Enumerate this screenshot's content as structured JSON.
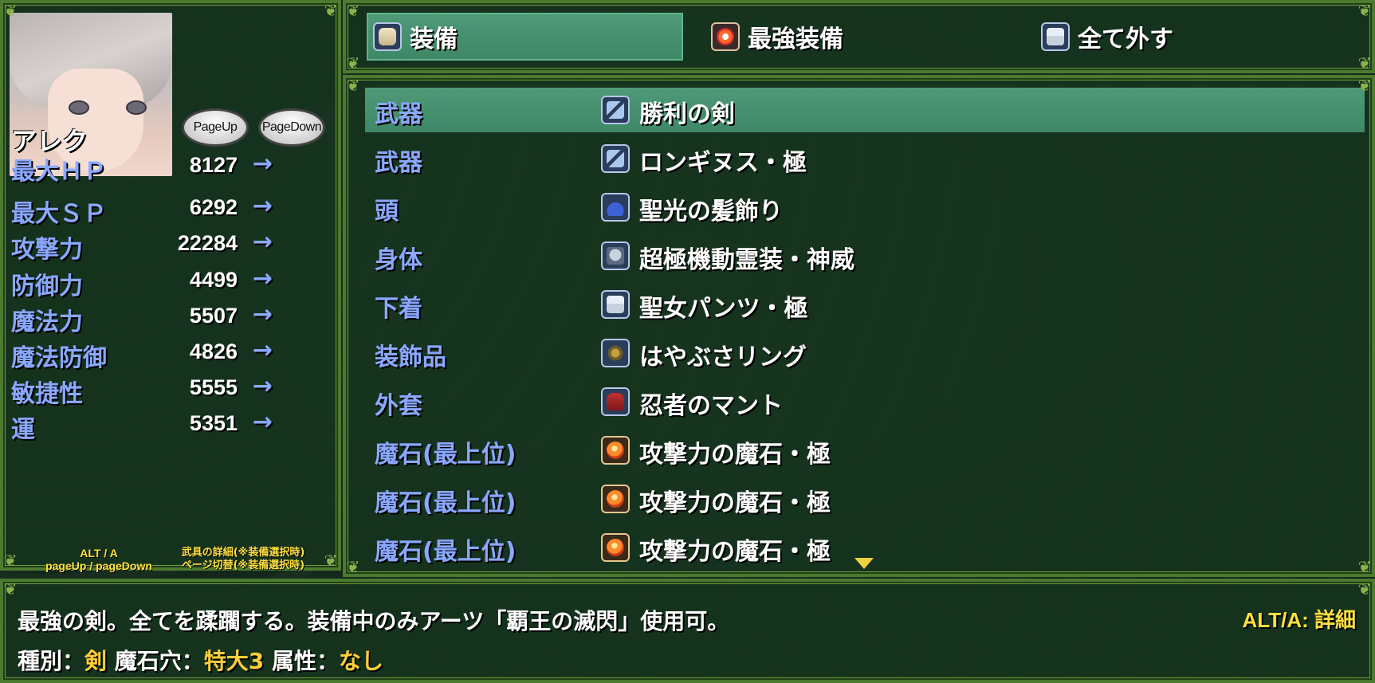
{
  "character": {
    "name": "アレク",
    "page_up_label": "PageUp",
    "page_down_label": "PageDown",
    "stats": [
      {
        "label": "最大ＨＰ",
        "value": "8127",
        "arrow": "→"
      },
      {
        "label": "最大ＳＰ",
        "value": "6292",
        "arrow": "→"
      },
      {
        "label": "攻撃力",
        "value": "22284",
        "arrow": "→"
      },
      {
        "label": "防御力",
        "value": "4499",
        "arrow": "→"
      },
      {
        "label": "魔法力",
        "value": "5507",
        "arrow": "→"
      },
      {
        "label": "魔法防御",
        "value": "4826",
        "arrow": "→"
      },
      {
        "label": "敏捷性",
        "value": "5555",
        "arrow": "→"
      },
      {
        "label": "運",
        "value": "5351",
        "arrow": "→"
      }
    ],
    "help_keys_1": "ALT / A",
    "help_keys_2": "pageUp / pageDown",
    "help_desc_1": "武具の詳細(※装備選択時)",
    "help_desc_2": "ページ切替(※装備選択時)"
  },
  "commands": [
    {
      "label": "装備",
      "icon": "equip-icon",
      "selected": true
    },
    {
      "label": "最強装備",
      "icon": "best-equip-icon",
      "selected": false
    },
    {
      "label": "全て外す",
      "icon": "unequip-icon",
      "selected": false
    }
  ],
  "equipment": [
    {
      "slot": "武器",
      "item": "勝利の剣",
      "icon": "sword-icon",
      "selected": true
    },
    {
      "slot": "武器",
      "item": "ロンギヌス・極",
      "icon": "sword-icon"
    },
    {
      "slot": "頭",
      "item": "聖光の髪飾り",
      "icon": "hat-icon"
    },
    {
      "slot": "身体",
      "item": "超極機動霊装・神威",
      "icon": "armor-icon"
    },
    {
      "slot": "下着",
      "item": "聖女パンツ・極",
      "icon": "pants-icon"
    },
    {
      "slot": "装飾品",
      "item": "はやぶさリング",
      "icon": "ring-icon"
    },
    {
      "slot": "外套",
      "item": "忍者のマント",
      "icon": "cape-icon"
    },
    {
      "slot": "魔石(最上位)",
      "item": "攻撃力の魔石・極",
      "icon": "gem-icon"
    },
    {
      "slot": "魔石(最上位)",
      "item": "攻撃力の魔石・極",
      "icon": "gem-icon"
    },
    {
      "slot": "魔石(最上位)",
      "item": "攻撃力の魔石・極",
      "icon": "gem-icon"
    }
  ],
  "help": {
    "description": "最強の剣。全てを蹂躙する。装備中のみアーツ「覇王の滅閃」使用可。",
    "alt_hint": "ALT/A: 詳細",
    "type_label": "種別：",
    "type_value": "剣",
    "slots_label": "魔石穴：",
    "slots_value": "特大3",
    "element_label": "属性：",
    "element_value": "なし"
  },
  "colors": {
    "label_blue": "#8aa8ff",
    "highlight_yellow": "#ffcf3a",
    "selection_green": "#4f9a79",
    "frame_green": "#4c7a2e"
  }
}
